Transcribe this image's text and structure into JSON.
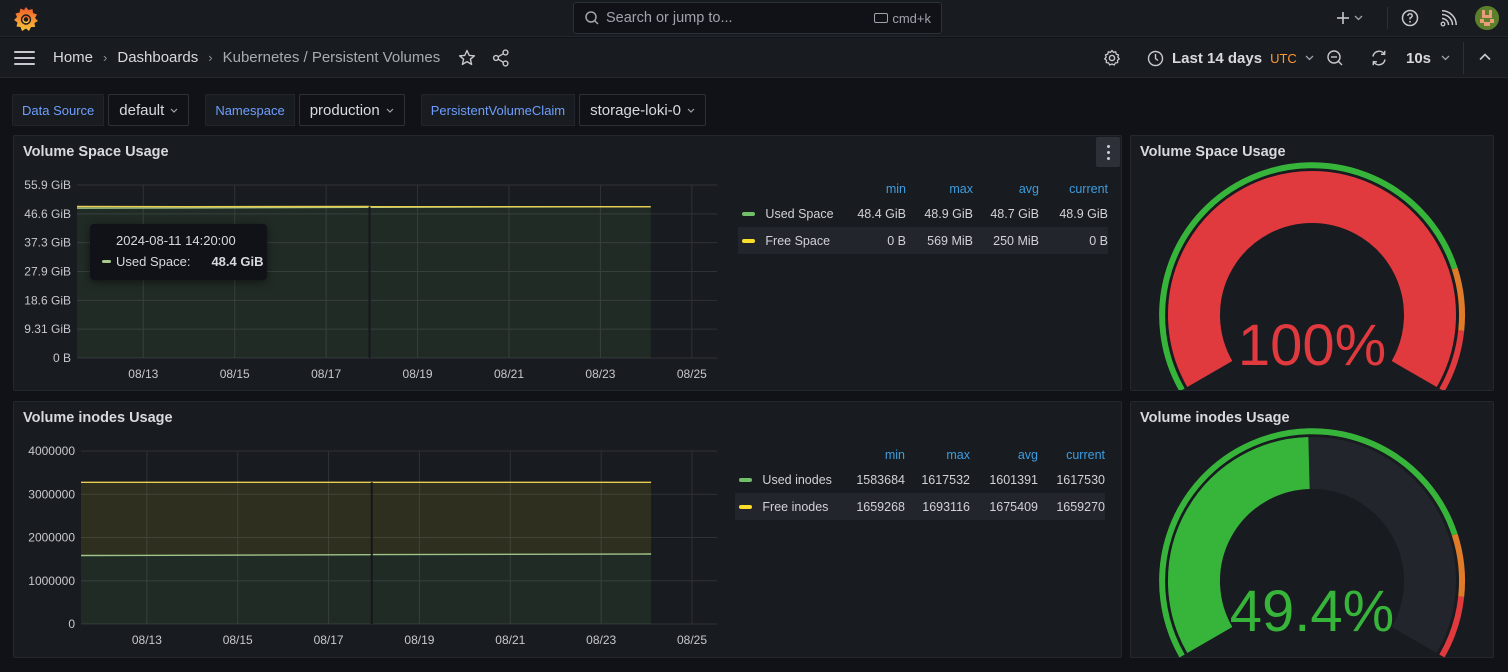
{
  "topbar": {
    "search_placeholder": "Search or jump to...",
    "search_shortcut": "cmd+k",
    "icons": [
      "grafana-logo-icon",
      "search-icon",
      "keyboard-icon",
      "plus-icon",
      "help-icon",
      "news-rss-icon",
      "user-avatar"
    ]
  },
  "navbar": {
    "breadcrumbs": [
      {
        "label": "Home"
      },
      {
        "label": "Dashboards"
      },
      {
        "label": "Kubernetes / Persistent Volumes"
      }
    ],
    "time_range": "Last 14 days",
    "timezone": "UTC",
    "refresh_interval": "10s"
  },
  "variables": [
    {
      "label": "Data Source",
      "value": "default"
    },
    {
      "label": "Namespace",
      "value": "production"
    },
    {
      "label": "PersistentVolumeClaim",
      "value": "storage-loki-0"
    }
  ],
  "colors": {
    "used_series": "#73bf69",
    "free_series": "#fade2a",
    "gauge_green": "#37b53b",
    "gauge_orange": "#e07b2a",
    "gauge_red": "#e0393e",
    "legend_header": "#3d9de0",
    "variable_label": "#6e9fff",
    "timezone": "#ff9830"
  },
  "panels": {
    "space_ts": {
      "title": "Volume Space Usage",
      "legend": {
        "columns": [
          "min",
          "max",
          "avg",
          "current"
        ],
        "rows": [
          {
            "name": "Used Space",
            "min": "48.4 GiB",
            "max": "48.9 GiB",
            "avg": "48.7 GiB",
            "current": "48.9 GiB"
          },
          {
            "name": "Free Space",
            "min": "0 B",
            "max": "569 MiB",
            "avg": "250 MiB",
            "current": "0 B"
          }
        ]
      },
      "tooltip": {
        "time": "2024-08-11 14:20:00",
        "series": "Used Space:",
        "value": "48.4 GiB"
      }
    },
    "space_gauge": {
      "title": "Volume Space Usage",
      "value_text": "100%",
      "value": 100,
      "color": "red"
    },
    "inodes_ts": {
      "title": "Volume inodes Usage",
      "legend": {
        "columns": [
          "min",
          "max",
          "avg",
          "current"
        ],
        "rows": [
          {
            "name": "Used inodes",
            "min": "1583684",
            "max": "1617532",
            "avg": "1601391",
            "current": "1617530"
          },
          {
            "name": "Free inodes",
            "min": "1659268",
            "max": "1693116",
            "avg": "1675409",
            "current": "1659270"
          }
        ]
      }
    },
    "inodes_gauge": {
      "title": "Volume inodes Usage",
      "value_text": "49.4%",
      "value": 49.4,
      "color": "green"
    }
  },
  "chart_data": [
    {
      "type": "area",
      "title": "Volume Space Usage",
      "stacked": true,
      "xlabel": "",
      "ylabel": "",
      "x_ticks": [
        "08/13",
        "08/15",
        "08/17",
        "08/19",
        "08/21",
        "08/23",
        "08/25"
      ],
      "x_range_days": [
        11.55,
        25.55
      ],
      "y_ticks": [
        "0 B",
        "9.31 GiB",
        "18.6 GiB",
        "27.9 GiB",
        "37.3 GiB",
        "46.6 GiB",
        "55.9 GiB"
      ],
      "ylim_gib": [
        0,
        55.9
      ],
      "grid": true,
      "legend": "right",
      "series": [
        {
          "name": "Used Space",
          "unit": "GiB",
          "points": [
            [
              11.55,
              48.4
            ],
            [
              14.0,
              48.5
            ],
            [
              17.9,
              48.7
            ],
            [
              18.0,
              48.7
            ],
            [
              20.0,
              48.8
            ],
            [
              24.1,
              48.9
            ]
          ]
        },
        {
          "name": "Free Space",
          "unit": "GiB",
          "points": [
            [
              11.55,
              0.55
            ],
            [
              14.0,
              0.4
            ],
            [
              17.9,
              0.25
            ],
            [
              18.0,
              0.2
            ],
            [
              20.0,
              0.1
            ],
            [
              24.1,
              0.0
            ]
          ]
        }
      ],
      "gap_at_day": 17.95
    },
    {
      "type": "area",
      "title": "Volume inodes Usage",
      "stacked": true,
      "xlabel": "",
      "ylabel": "",
      "x_ticks": [
        "08/13",
        "08/15",
        "08/17",
        "08/19",
        "08/21",
        "08/23",
        "08/25"
      ],
      "x_range_days": [
        11.55,
        25.55
      ],
      "y_ticks": [
        "0",
        "1000000",
        "2000000",
        "3000000",
        "4000000"
      ],
      "ylim": [
        0,
        4000000
      ],
      "grid": true,
      "legend": "right",
      "series": [
        {
          "name": "Used inodes",
          "points": [
            [
              11.55,
              1583684
            ],
            [
              14.5,
              1590000
            ],
            [
              17.9,
              1601391
            ],
            [
              18.0,
              1605000
            ],
            [
              21.0,
              1612000
            ],
            [
              24.1,
              1617530
            ]
          ]
        },
        {
          "name": "Free inodes",
          "points": [
            [
              11.55,
              1693116
            ],
            [
              14.5,
              1686800
            ],
            [
              17.9,
              1675409
            ],
            [
              18.0,
              1671800
            ],
            [
              21.0,
              1664800
            ],
            [
              24.1,
              1659270
            ]
          ]
        }
      ],
      "gap_at_day": 17.95
    },
    {
      "type": "gauge",
      "title": "Volume Space Usage",
      "value": 100,
      "unit": "%",
      "min": 0,
      "max": 100,
      "thresholds": [
        {
          "from": 0,
          "color": "green"
        },
        {
          "from": 80,
          "color": "orange"
        },
        {
          "from": 90,
          "color": "red"
        }
      ]
    },
    {
      "type": "gauge",
      "title": "Volume inodes Usage",
      "value": 49.4,
      "unit": "%",
      "min": 0,
      "max": 100,
      "thresholds": [
        {
          "from": 0,
          "color": "green"
        },
        {
          "from": 80,
          "color": "orange"
        },
        {
          "from": 90,
          "color": "red"
        }
      ]
    }
  ]
}
